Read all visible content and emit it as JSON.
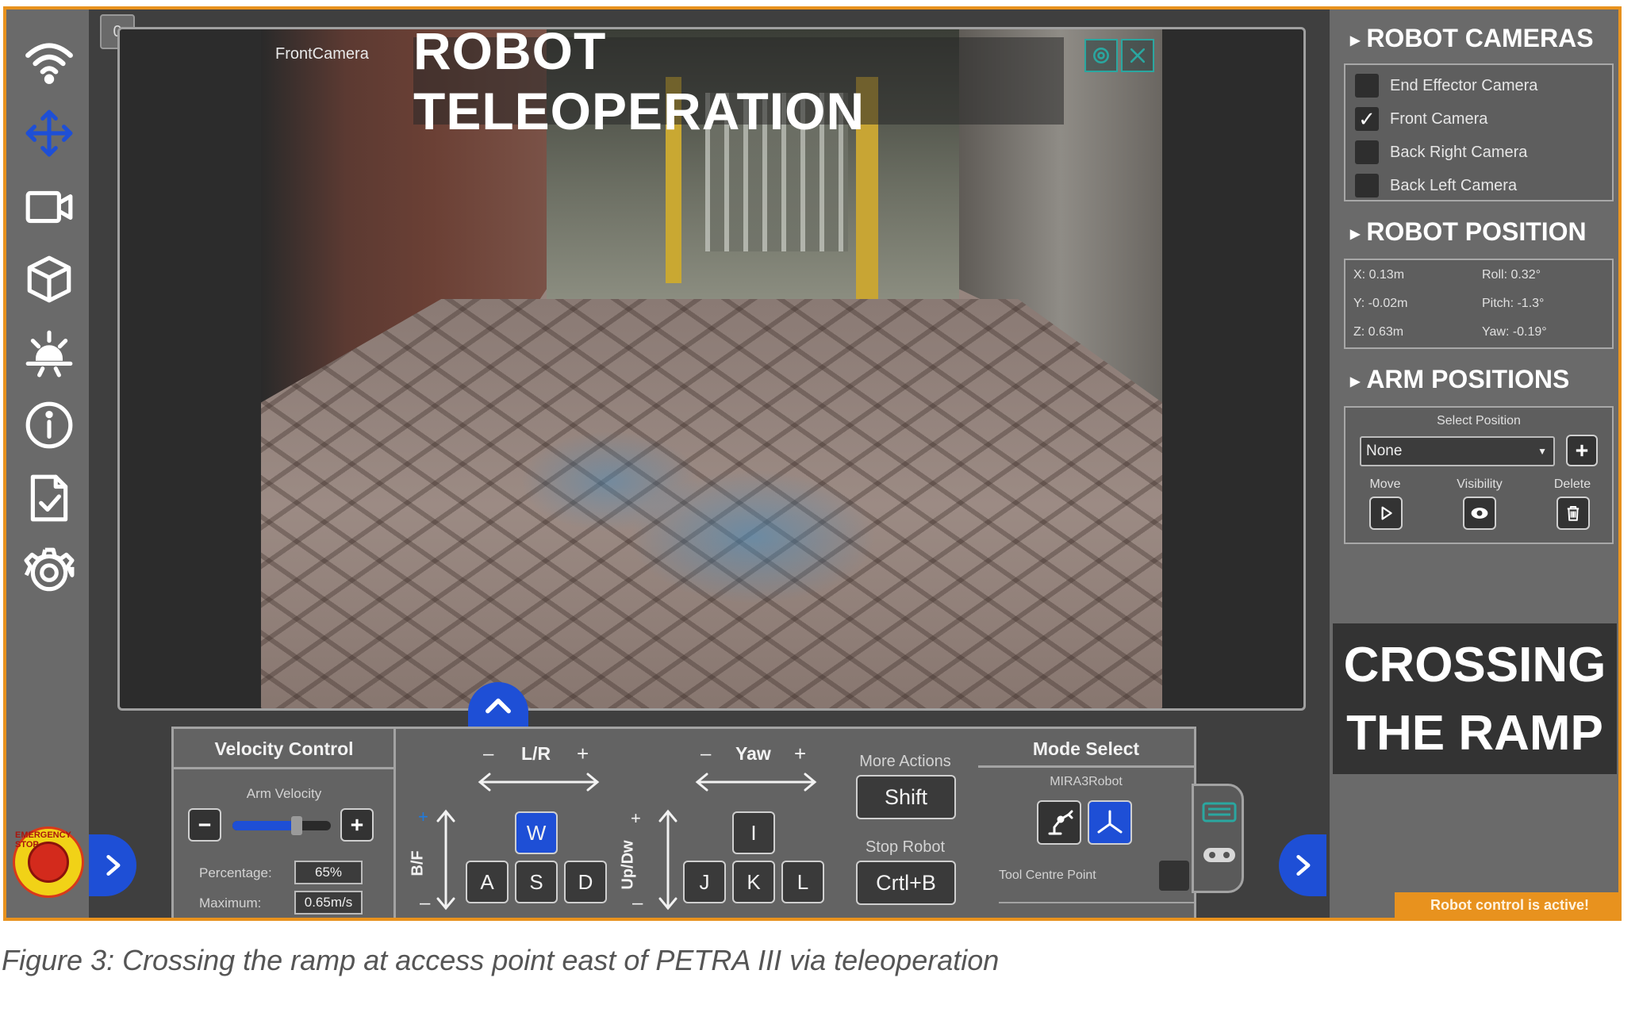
{
  "counter_badge": "0",
  "sidebar": {
    "icons": [
      "wifi-icon",
      "move-arrows-icon",
      "video-camera-icon",
      "cube-icon",
      "light-icon",
      "info-icon",
      "checklist-icon",
      "gear-icon"
    ],
    "estop_label": "EMERGENCY STOP",
    "accent": "#1e4fd6"
  },
  "camera": {
    "label": "FrontCamera",
    "title": "ROBOT TELEOPERATION"
  },
  "velocity_control": {
    "title": "Velocity Control",
    "arm_velocity_label": "Arm Velocity",
    "slider_fraction": 0.65,
    "percentage_label": "Percentage:",
    "percentage_value": "65%",
    "maximum_label": "Maximum:",
    "maximum_value": "0.65m/s"
  },
  "drive_keys": {
    "lr_minus": "–",
    "lr_label": "L/R",
    "lr_plus": "+",
    "bf_label": "B/F",
    "bf_plus": "+",
    "bf_minus": "–",
    "keys": [
      "W",
      "A",
      "S",
      "D"
    ]
  },
  "arm_keys": {
    "yaw_minus": "–",
    "yaw_label": "Yaw",
    "yaw_plus": "+",
    "updw_label": "Up/Dw",
    "updw_plus": "+",
    "updw_minus": "–",
    "keys": [
      "I",
      "J",
      "K",
      "L"
    ]
  },
  "actions": {
    "more_actions_label": "More Actions",
    "shift_label": "Shift",
    "stop_robot_label": "Stop Robot",
    "stop_shortcut": "Crtl+B"
  },
  "mode_select": {
    "title": "Mode Select",
    "robot_name": "MIRA3Robot",
    "tool_centre_point_label": "Tool Centre Point"
  },
  "right_panel": {
    "cameras_header": "ROBOT CAMERAS",
    "cameras": [
      {
        "label": "End Effector Camera",
        "checked": false
      },
      {
        "label": "Front Camera",
        "checked": true
      },
      {
        "label": "Back Right Camera",
        "checked": false
      },
      {
        "label": "Back Left Camera",
        "checked": false
      }
    ],
    "position_header": "ROBOT POSITION",
    "position": {
      "x": "X: 0.13m",
      "y": "Y: -0.02m",
      "z": "Z: 0.63m",
      "roll": "Roll: 0.32°",
      "pitch": "Pitch: -1.3°",
      "yaw": "Yaw: -0.19°"
    },
    "arm_header": "ARM POSITIONS",
    "select_position_label": "Select Position",
    "select_value": "None",
    "move_label": "Move",
    "visibility_label": "Visibility",
    "delete_label": "Delete",
    "banner_line1": "CROSSING",
    "banner_line2": "THE RAMP",
    "status": "Robot control is active!"
  },
  "caption": "Figure 3: Crossing the ramp at access point east of PETRA III via teleoperation"
}
